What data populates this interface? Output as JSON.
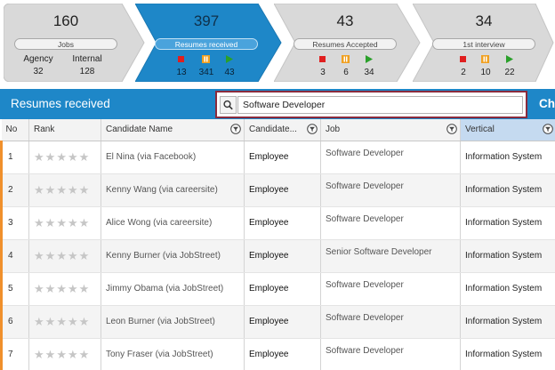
{
  "pipeline": {
    "stages": [
      {
        "count": "160",
        "label": "Jobs",
        "subs": [
          {
            "label": "Agency",
            "value": "32"
          },
          {
            "label": "Internal",
            "value": "128"
          }
        ]
      },
      {
        "count": "397",
        "label": "Resumes received",
        "stats": [
          "13",
          "341",
          "43"
        ]
      },
      {
        "count": "43",
        "label": "Resumes Accepted",
        "stats": [
          "3",
          "6",
          "34"
        ]
      },
      {
        "count": "34",
        "label": "1st interview",
        "stats": [
          "2",
          "10",
          "22"
        ]
      }
    ],
    "colors": {
      "active": "#1e87c8",
      "inactive": "#d9d9d9",
      "stop": "#e01f1f",
      "pause": "#f0a020",
      "play": "#2aa02a"
    }
  },
  "header": {
    "title": "Resumes received",
    "next_label": "Ch",
    "search_value": "Software Developer",
    "icon": "search-icon"
  },
  "grid": {
    "columns": [
      "No",
      "Rank",
      "Candidate Name",
      "Candidate...",
      "Job",
      "Vertical"
    ],
    "rows": [
      {
        "no": "1",
        "candidate": "El Nina (via Facebook)",
        "type": "Employee",
        "job": "Software Developer",
        "vertical": "Information System"
      },
      {
        "no": "2",
        "candidate": "Kenny Wang (via careersite)",
        "type": "Employee",
        "job": "Software Developer",
        "vertical": "Information System"
      },
      {
        "no": "3",
        "candidate": "Alice Wong  (via careersite)",
        "type": "Employee",
        "job": "Software Developer",
        "vertical": "Information System"
      },
      {
        "no": "4",
        "candidate": "Kenny Burner (via JobStreet)",
        "type": "Employee",
        "job": "Senior Software Developer",
        "vertical": "Information System"
      },
      {
        "no": "5",
        "candidate": "Jimmy Obama (via JobStreet)",
        "type": "Employee",
        "job": "Software Developer",
        "vertical": "Information System"
      },
      {
        "no": "6",
        "candidate": "Leon Burner (via JobStreet)",
        "type": "Employee",
        "job": "Software Developer",
        "vertical": "Information System"
      },
      {
        "no": "7",
        "candidate": "Tony Fraser (via JobStreet)",
        "type": "Employee",
        "job": "Software Developer",
        "vertical": "Information System"
      }
    ]
  }
}
